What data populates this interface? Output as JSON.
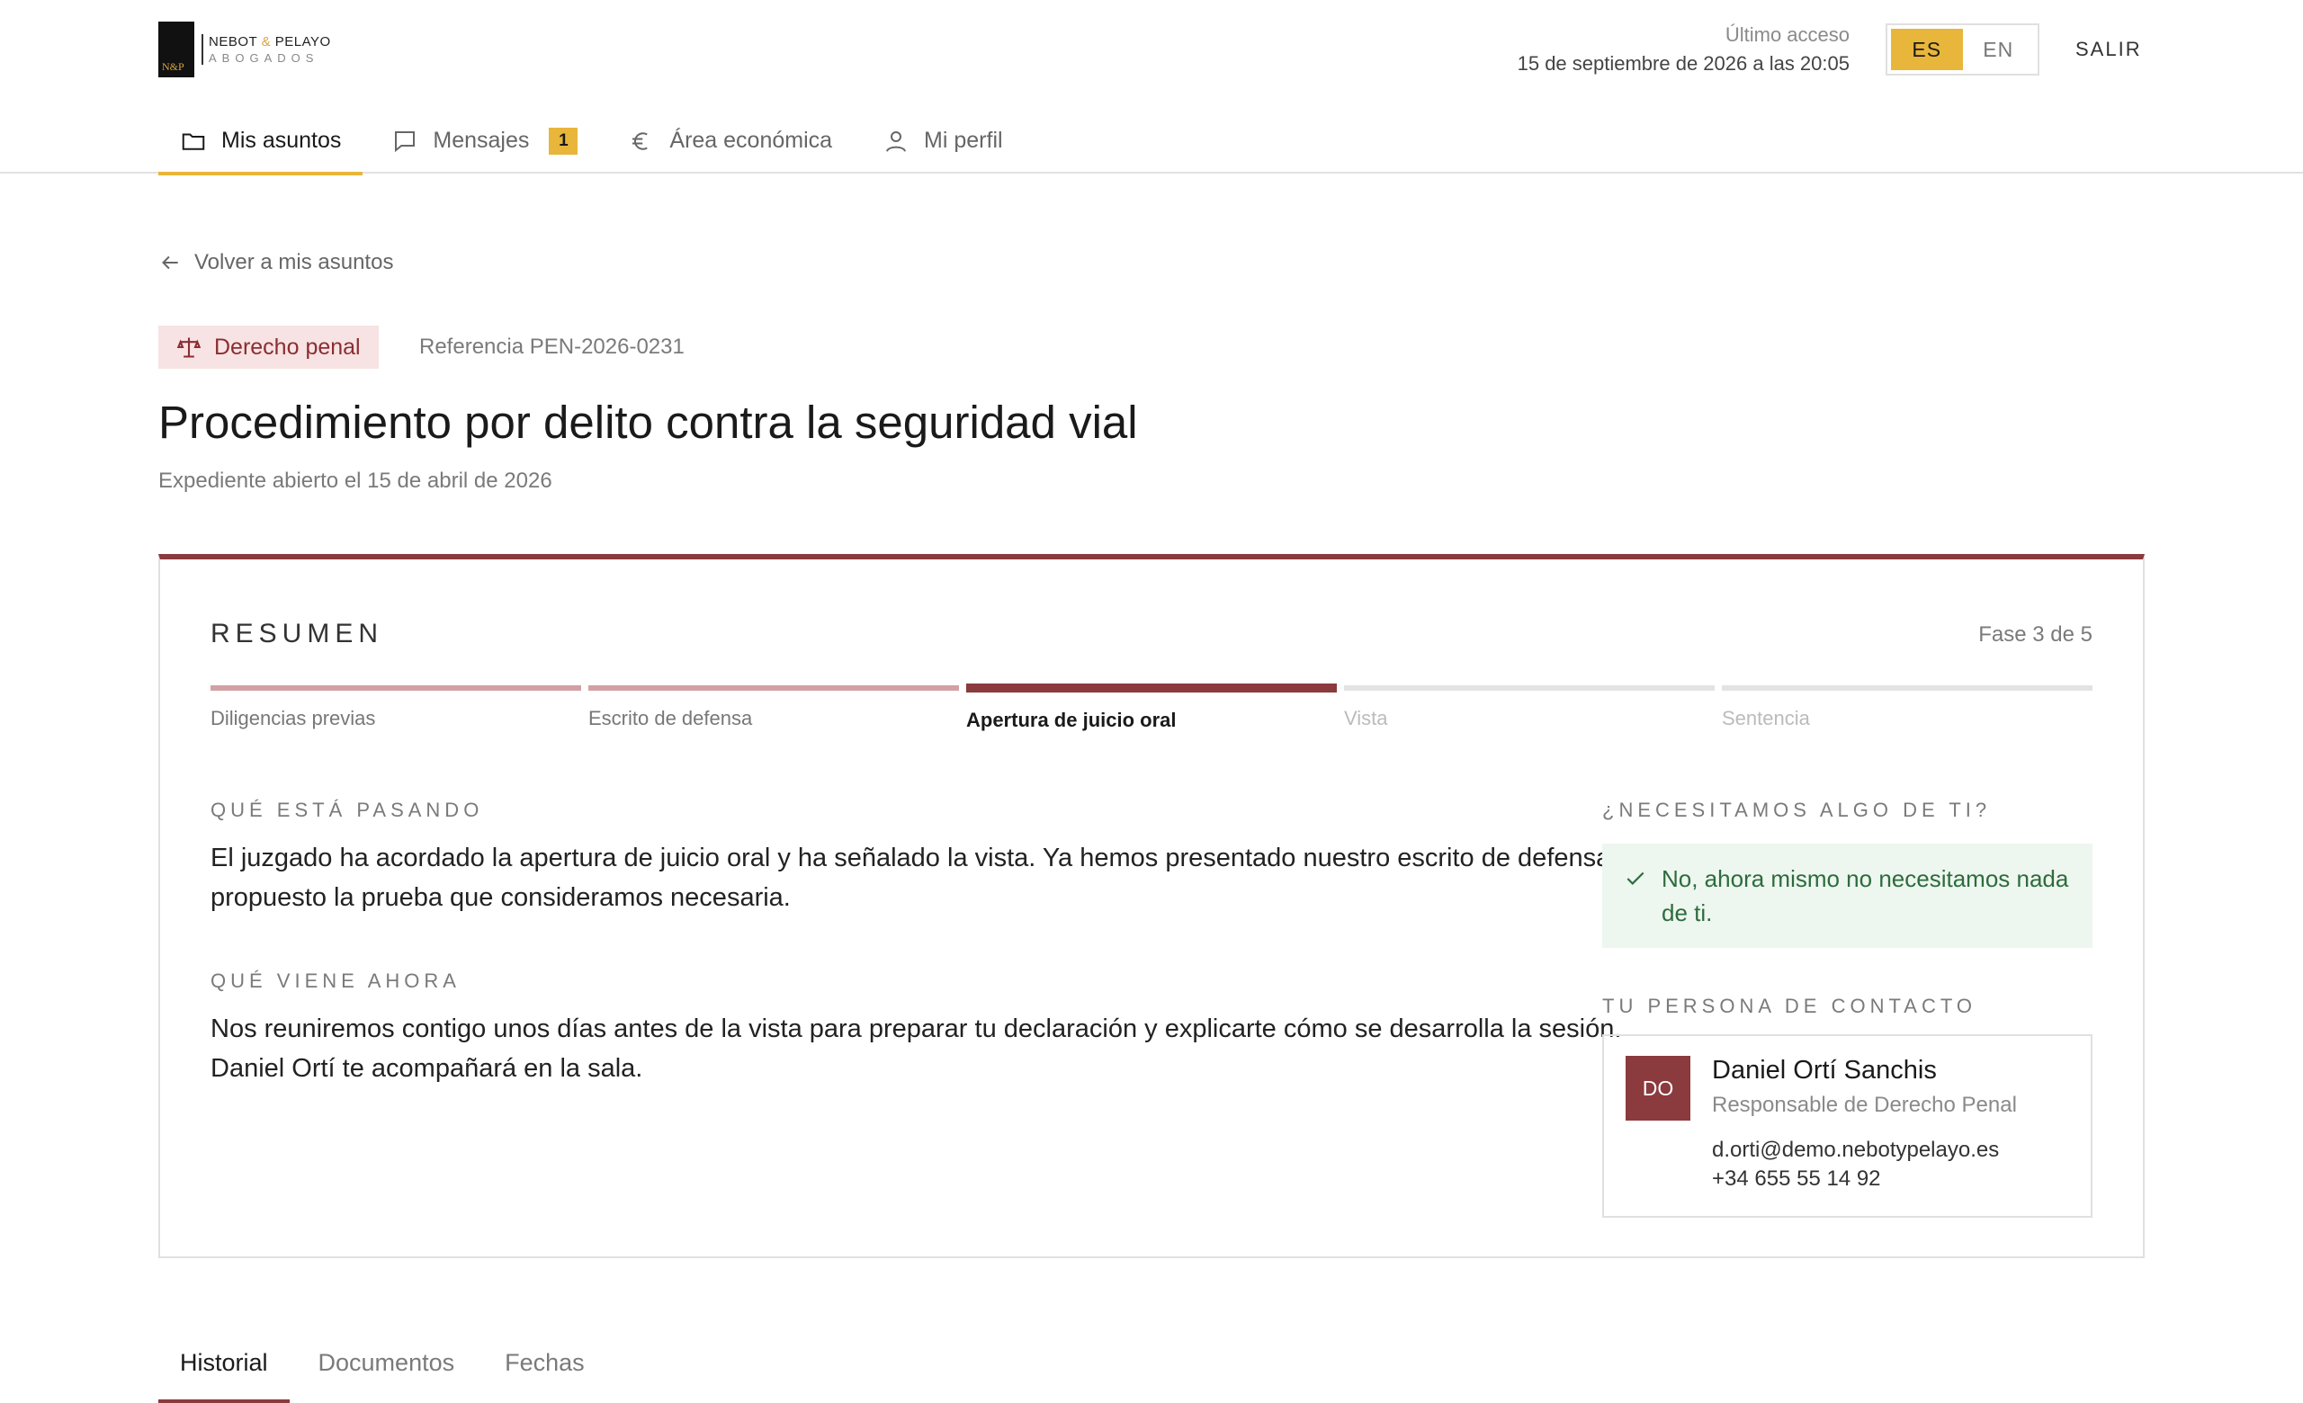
{
  "brand": {
    "mark": "N&P",
    "name_left": "NEBOT",
    "name_amp": "&",
    "name_right": "PELAYO",
    "sub": "ABOGADOS"
  },
  "header": {
    "last_access_label": "Último acceso",
    "last_access_date": "15 de septiembre de 2026 a las 20:05",
    "languages": [
      "ES",
      "EN"
    ],
    "active_language": "ES",
    "logout": "SALIR"
  },
  "nav": {
    "items": [
      {
        "label": "Mis asuntos",
        "icon": "folder-icon",
        "active": true
      },
      {
        "label": "Mensajes",
        "icon": "message-icon",
        "badge": "1"
      },
      {
        "label": "Área económica",
        "icon": "euro-icon"
      },
      {
        "label": "Mi perfil",
        "icon": "user-icon"
      }
    ]
  },
  "back_link": "Volver a mis asuntos",
  "matter": {
    "area": "Derecho penal",
    "area_icon": "scales-icon",
    "reference": "Referencia PEN-2026-0231",
    "title": "Procedimiento por delito contra la seguridad vial",
    "opened": "Expediente abierto el 15 de abril de 2026"
  },
  "summary": {
    "title": "RESUMEN",
    "phase_count": "Fase 3 de 5",
    "steps": [
      {
        "label": "Diligencias previas",
        "state": "done"
      },
      {
        "label": "Escrito de defensa",
        "state": "done"
      },
      {
        "label": "Apertura de juicio oral",
        "state": "current"
      },
      {
        "label": "Vista",
        "state": "pending"
      },
      {
        "label": "Sentencia",
        "state": "pending"
      }
    ],
    "now_heading": "QUÉ ESTÁ PASANDO",
    "now_text": "El juzgado ha acordado la apertura de juicio oral y ha señalado la vista. Ya hemos presentado nuestro escrito de defensa y propuesto la prueba que consideramos necesaria.",
    "next_heading": "QUÉ VIENE AHORA",
    "next_text": "Nos reuniremos contigo unos días antes de la vista para preparar tu declaración y explicarte cómo se desarrolla la sesión. Daniel Ortí te acompañará en la sala.",
    "need_heading": "¿NECESITAMOS ALGO DE TI?",
    "need_text": "No, ahora mismo no necesitamos nada de ti.",
    "contact_heading": "TU PERSONA DE CONTACTO",
    "contact": {
      "initials": "DO",
      "name": "Daniel Ortí Sanchis",
      "role": "Responsable de Derecho Penal",
      "email": "d.orti@demo.nebotypelayo.es",
      "phone": "+34 655 55 14 92"
    }
  },
  "tabs": [
    {
      "label": "Historial",
      "active": true
    },
    {
      "label": "Documentos"
    },
    {
      "label": "Fechas"
    }
  ],
  "colors": {
    "accent": "#e8b63a",
    "brand": "#8b3a3e",
    "success_bg": "#edf6ef",
    "success_text": "#2e6b3d"
  }
}
